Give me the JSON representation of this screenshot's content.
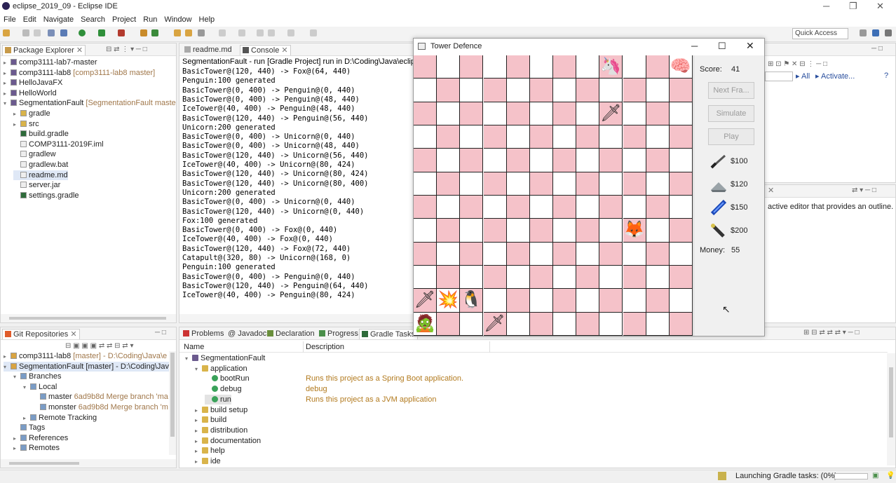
{
  "window": {
    "title": "eclipse_2019_09 - Eclipse IDE"
  },
  "menu": [
    "File",
    "Edit",
    "Navigate",
    "Search",
    "Project",
    "Run",
    "Window",
    "Help"
  ],
  "quick_access": "Quick Access",
  "package_explorer": {
    "tab": "Package Explorer",
    "items": [
      {
        "label": "comp3111-lab7-master",
        "deco": "",
        "depth": 0,
        "twisty": "▸",
        "icon": "project"
      },
      {
        "label": "comp3111-lab8",
        "deco": "[comp3111-lab8 master]",
        "depth": 0,
        "twisty": "▸",
        "icon": "project"
      },
      {
        "label": "HelloJavaFX",
        "deco": "",
        "depth": 0,
        "twisty": "▸",
        "icon": "project"
      },
      {
        "label": "HelloWorld",
        "deco": "",
        "depth": 0,
        "twisty": "▸",
        "icon": "project"
      },
      {
        "label": "SegmentationFault",
        "deco": "[SegmentationFault master]",
        "depth": 0,
        "twisty": "▾",
        "icon": "project"
      },
      {
        "label": "gradle",
        "deco": "",
        "depth": 1,
        "twisty": "▸",
        "icon": "folder"
      },
      {
        "label": "src",
        "deco": "",
        "depth": 1,
        "twisty": "▸",
        "icon": "folder"
      },
      {
        "label": "build.gradle",
        "deco": "",
        "depth": 1,
        "twisty": "",
        "icon": "gradle"
      },
      {
        "label": "COMP3111-2019F.iml",
        "deco": "",
        "depth": 1,
        "twisty": "",
        "icon": "file"
      },
      {
        "label": "gradlew",
        "deco": "",
        "depth": 1,
        "twisty": "",
        "icon": "file"
      },
      {
        "label": "gradlew.bat",
        "deco": "",
        "depth": 1,
        "twisty": "",
        "icon": "file"
      },
      {
        "label": "readme.md",
        "deco": "",
        "depth": 1,
        "twisty": "",
        "icon": "file"
      },
      {
        "label": "server.jar",
        "deco": "",
        "depth": 1,
        "twisty": "",
        "icon": "file"
      },
      {
        "label": "settings.gradle",
        "deco": "",
        "depth": 1,
        "twisty": "",
        "icon": "gradle"
      }
    ]
  },
  "editor_tabs": [
    "readme.md",
    "Console"
  ],
  "console": {
    "header": "SegmentationFault - run [Gradle Project] run in D:\\Coding\\Java\\eclipse_",
    "lines": [
      "BasicTower@(120, 440) -> Fox@(64, 440)",
      "Penguin:100 generated",
      "BasicTower@(0, 400) -> Penguin@(0, 440)",
      "BasicTower@(0, 400) -> Penguin@(48, 440)",
      "IceTower@(40, 400) -> Penguin@(48, 440)",
      "BasicTower@(120, 440) -> Penguin@(56, 440)",
      "Unicorn:200 generated",
      "BasicTower@(0, 400) -> Unicorn@(0, 440)",
      "BasicTower@(0, 400) -> Unicorn@(48, 440)",
      "BasicTower@(120, 440) -> Unicorn@(56, 440)",
      "IceTower@(40, 400) -> Unicorn@(80, 424)",
      "BasicTower@(120, 440) -> Unicorn@(80, 424)",
      "BasicTower@(120, 440) -> Unicorn@(80, 400)",
      "Unicorn:200 generated",
      "BasicTower@(0, 400) -> Unicorn@(0, 440)",
      "BasicTower@(120, 440) -> Unicorn@(0, 440)",
      "Fox:100 generated",
      "BasicTower@(0, 400) -> Fox@(0, 440)",
      "IceTower@(40, 400) -> Fox@(0, 440)",
      "BasicTower@(120, 440) -> Fox@(72, 440)",
      "Catapult@(320, 80) -> Unicorn@(168, 0)",
      "Penguin:100 generated",
      "BasicTower@(0, 400) -> Penguin@(0, 440)",
      "BasicTower@(120, 440) -> Penguin@(64, 440)",
      "IceTower@(40, 400) -> Penguin@(80, 424)"
    ]
  },
  "right_panel": {
    "all": "All",
    "activate": "Activate...",
    "outline_msg": "active editor that provides an outline."
  },
  "git": {
    "tab": "Git Repositories",
    "items": [
      {
        "label": "comp3111-lab8",
        "deco": "[master] - D:\\Coding\\Java\\e",
        "depth": 0,
        "twisty": "▸"
      },
      {
        "label": "SegmentationFault [master] - D:\\Coding\\Java",
        "deco": "",
        "depth": 0,
        "twisty": "▾"
      },
      {
        "label": "Branches",
        "deco": "",
        "depth": 1,
        "twisty": "▾"
      },
      {
        "label": "Local",
        "deco": "",
        "depth": 2,
        "twisty": "▾"
      },
      {
        "label": "master",
        "deco": "6ad9b8d Merge branch 'ma",
        "depth": 3,
        "twisty": ""
      },
      {
        "label": "monster",
        "deco": "6ad9b8d Merge branch 'm",
        "depth": 3,
        "twisty": ""
      },
      {
        "label": "Remote Tracking",
        "deco": "",
        "depth": 2,
        "twisty": "▸"
      },
      {
        "label": "Tags",
        "deco": "",
        "depth": 1,
        "twisty": ""
      },
      {
        "label": "References",
        "deco": "",
        "depth": 1,
        "twisty": "▸"
      },
      {
        "label": "Remotes",
        "deco": "",
        "depth": 1,
        "twisty": "▸"
      }
    ]
  },
  "bottom_tabs": [
    "Problems",
    "Javadoc",
    "Declaration",
    "Progress",
    "Gradle Tasks"
  ],
  "gradle": {
    "col_name": "Name",
    "col_desc": "Description",
    "rows": [
      {
        "name": "SegmentationFault",
        "desc": "",
        "depth": 0,
        "twisty": "▾",
        "kind": "project"
      },
      {
        "name": "application",
        "desc": "",
        "depth": 1,
        "twisty": "▾",
        "kind": "group"
      },
      {
        "name": "bootRun",
        "desc": "Runs this project as a Spring Boot application.",
        "depth": 2,
        "twisty": "",
        "kind": "task"
      },
      {
        "name": "debug",
        "desc": "debug",
        "depth": 2,
        "twisty": "",
        "kind": "task"
      },
      {
        "name": "run",
        "desc": "Runs this project as a JVM application",
        "depth": 2,
        "twisty": "",
        "kind": "task"
      },
      {
        "name": "build setup",
        "desc": "",
        "depth": 1,
        "twisty": "▸",
        "kind": "group"
      },
      {
        "name": "build",
        "desc": "",
        "depth": 1,
        "twisty": "▸",
        "kind": "group"
      },
      {
        "name": "distribution",
        "desc": "",
        "depth": 1,
        "twisty": "▸",
        "kind": "group"
      },
      {
        "name": "documentation",
        "desc": "",
        "depth": 1,
        "twisty": "▸",
        "kind": "group"
      },
      {
        "name": "help",
        "desc": "",
        "depth": 1,
        "twisty": "▸",
        "kind": "group"
      },
      {
        "name": "ide",
        "desc": "",
        "depth": 1,
        "twisty": "▸",
        "kind": "group"
      }
    ]
  },
  "status": {
    "message": "Launching Gradle tasks: (0%)"
  },
  "game": {
    "title": "Tower Defence",
    "score_label": "Score:",
    "score": "41",
    "buttons": [
      "Next Fra...",
      "Simulate",
      "Play"
    ],
    "shop": [
      {
        "price": "$100",
        "icon": "basic-tower-icon"
      },
      {
        "price": "$120",
        "icon": "catapult-icon"
      },
      {
        "price": "$150",
        "icon": "ice-tower-icon"
      },
      {
        "price": "$200",
        "icon": "laser-tower-icon"
      }
    ],
    "money_label": "Money:",
    "money": "55",
    "grid_cols": 12,
    "grid_rows": 12,
    "sprites": [
      {
        "name": "unicorn-sprite",
        "glyph": "🦄",
        "col": 8,
        "row": 0
      },
      {
        "name": "brain-sprite",
        "glyph": "🧠",
        "col": 11,
        "row": 0
      },
      {
        "name": "ice-tower-sprite",
        "glyph": "🗡",
        "col": 8,
        "row": 2
      },
      {
        "name": "fox-sprite",
        "glyph": "🦊",
        "col": 9,
        "row": 7
      },
      {
        "name": "basic-tower-sprite",
        "glyph": "🗡",
        "col": 0,
        "row": 10
      },
      {
        "name": "catapult-sprite",
        "glyph": "💥",
        "col": 1,
        "row": 10
      },
      {
        "name": "penguin-sprite",
        "glyph": "🐧",
        "col": 2,
        "row": 10
      },
      {
        "name": "zombie-sprite",
        "glyph": "🧟",
        "col": 0,
        "row": 11
      },
      {
        "name": "basic-tower-sprite-2",
        "glyph": "🗡",
        "col": 3,
        "row": 11
      }
    ]
  }
}
